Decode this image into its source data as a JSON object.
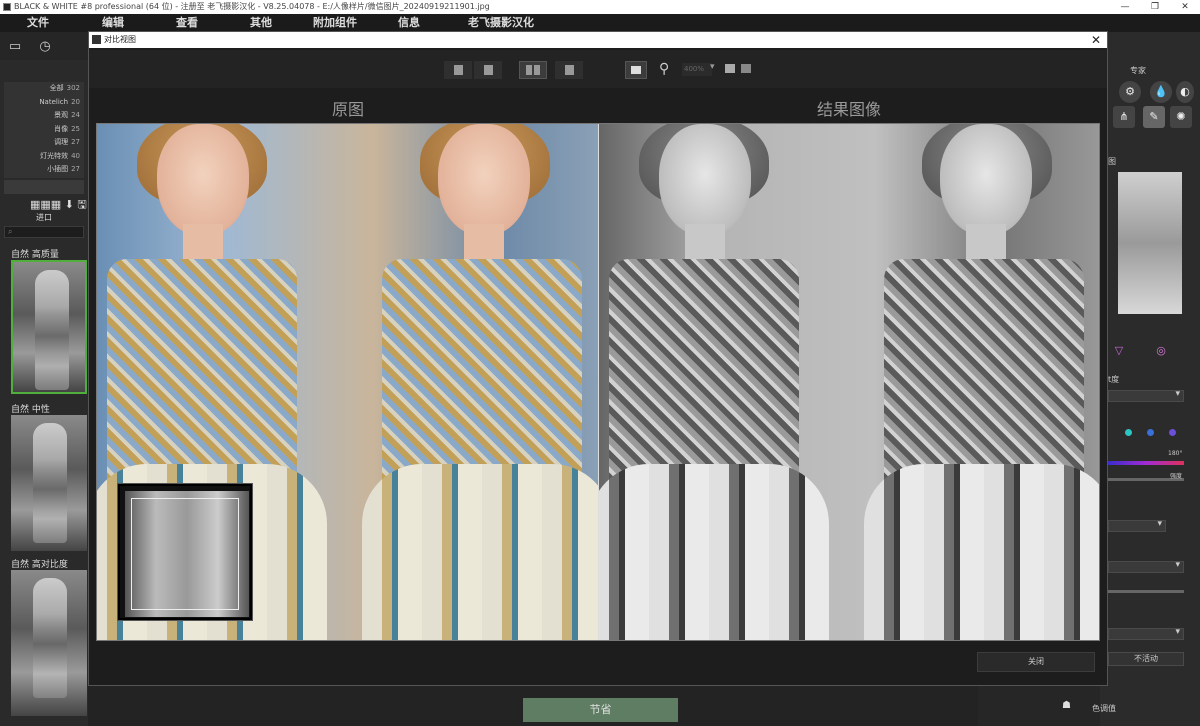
{
  "window": {
    "title": "BLACK & WHITE #8 professional (64 位) - 注册至 老飞摄影汉化 - V8.25.04078 - E:/人像样片/微信图片_20240919211901.jpg",
    "minimize": "—",
    "maximize": "❐",
    "close": "✕"
  },
  "menu": [
    "文件",
    "编辑",
    "查看",
    "其他",
    "附加组件",
    "信息",
    "老飞摄影汉化"
  ],
  "left_panel": {
    "categories": [
      {
        "name": "全部",
        "count": "302"
      },
      {
        "name": "Natelich",
        "count": "20"
      },
      {
        "name": "景观",
        "count": "24"
      },
      {
        "name": "肖像",
        "count": "25"
      },
      {
        "name": "调理",
        "count": "27"
      },
      {
        "name": "灯光特效",
        "count": "40"
      },
      {
        "name": "小插图",
        "count": "27"
      }
    ],
    "import_icon": "▦▦▦ ⬇ 🖫",
    "import_label": "进口",
    "presets": [
      {
        "label": "自然 高质量"
      },
      {
        "label": "自然 中性"
      },
      {
        "label": "自然 高对比度"
      }
    ]
  },
  "dialog": {
    "title": "对比视图",
    "close": "✕",
    "zoom_value": "400%",
    "left_label": "原图",
    "right_label": "结果图像",
    "close_button": "关闭"
  },
  "right_panel": {
    "tab": "专家",
    "label_image": "图",
    "label_brightness": "t度",
    "hue_end": "180°",
    "label_bright": "强度",
    "inactive_button": "不活动",
    "tone_label": "色调值"
  },
  "bottom": {
    "save_button": "节省"
  },
  "colors": {
    "accent_green": "#4fae3c",
    "save_green": "#5e7d62",
    "background": "#1a1a1a"
  }
}
